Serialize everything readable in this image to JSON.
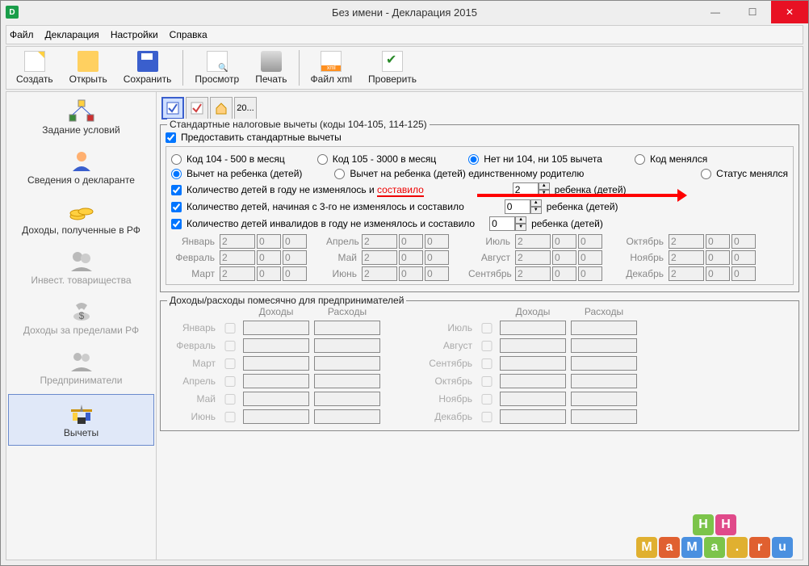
{
  "window": {
    "title": "Без имени - Декларация 2015"
  },
  "menu": {
    "file": "Файл",
    "decl": "Декларация",
    "settings": "Настройки",
    "help": "Справка"
  },
  "toolbar": {
    "create": "Создать",
    "open": "Открыть",
    "save": "Сохранить",
    "preview": "Просмотр",
    "print": "Печать",
    "xml": "Файл xml",
    "check": "Проверить"
  },
  "sidebar": {
    "items": [
      {
        "label": "Задание условий"
      },
      {
        "label": "Сведения о декларанте"
      },
      {
        "label": "Доходы, полученные в РФ"
      },
      {
        "label": "Инвест. товарищества",
        "disabled": true
      },
      {
        "label": "Доходы за пределами РФ",
        "disabled": true
      },
      {
        "label": "Предприниматели",
        "disabled": true
      },
      {
        "label": "Вычеты",
        "active": true
      }
    ]
  },
  "mini": {
    "tab20": "20..."
  },
  "std": {
    "legend": "Стандартные налоговые вычеты (коды 104-105, 114-125)",
    "provide": "Предоставить стандартные вычеты",
    "r104": "Код 104 - 500 в месяц",
    "r105": "Код 105 - 3000 в месяц",
    "rnone": "Нет ни 104, ни 105 вычета",
    "rchange": "Код менялся",
    "child1": "Вычет на ребенка (детей)",
    "child2": "Вычет на ребенка (детей) единственному родителю",
    "child3": "Статус менялся",
    "c1": "Количество детей в году не изменялось и",
    "c1a": "составило",
    "c2": "Количество детей, начиная с 3-го не изменялось и составило",
    "c3": "Количество детей инвалидов в году не изменялось и составило",
    "suffix": "ребенка (детей)",
    "v1": "2",
    "v2": "0",
    "v3": "0",
    "months": [
      "Январь",
      "Февраль",
      "Март",
      "Апрель",
      "Май",
      "Июнь",
      "Июль",
      "Август",
      "Сентябрь",
      "Октябрь",
      "Ноябрь",
      "Декабрь"
    ],
    "mv": {
      "a": "2",
      "b": "0",
      "c": "0"
    }
  },
  "entr": {
    "legend": "Доходы/расходы помесячно для предпринимателей",
    "inc": "Доходы",
    "exp": "Расходы",
    "months_l": [
      "Январь",
      "Февраль",
      "Март",
      "Апрель",
      "Май",
      "Июнь"
    ],
    "months_r": [
      "Июль",
      "Август",
      "Сентябрь",
      "Октябрь",
      "Ноябрь",
      "Декабрь"
    ]
  }
}
